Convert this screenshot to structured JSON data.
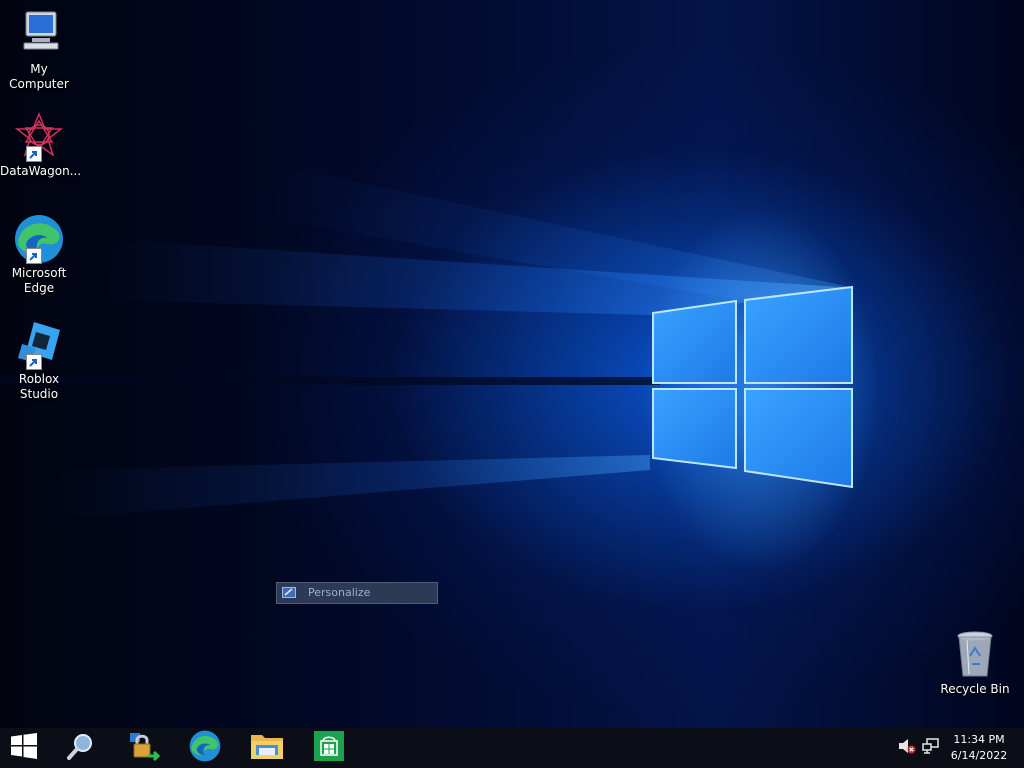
{
  "desktop": {
    "icons": [
      {
        "label": "My Computer",
        "icon": "computer-icon"
      },
      {
        "label": "DataWagon...",
        "icon": "datawagon-icon"
      },
      {
        "label": "Microsoft Edge",
        "icon": "edge-icon"
      },
      {
        "label": "Roblox Studio",
        "icon": "roblox-studio-icon"
      },
      {
        "label": "Recycle Bin",
        "icon": "recycle-bin-icon"
      }
    ],
    "context_menu": {
      "item": "Personalize",
      "icon": "personalize-icon"
    }
  },
  "taskbar": {
    "start": {
      "icon": "windows-start-icon"
    },
    "pinned": [
      {
        "icon": "search-icon"
      },
      {
        "icon": "security-lock-icon"
      },
      {
        "icon": "edge-icon"
      },
      {
        "icon": "file-explorer-icon"
      },
      {
        "icon": "store-icon"
      }
    ],
    "tray": {
      "volume_icon": "volume-muted-icon",
      "network_icon": "network-icon",
      "time": "11:34 PM",
      "date": "6/14/2022"
    }
  },
  "colors": {
    "taskbar": "#0b0e17",
    "wallpaper_accent": "#1a7cff",
    "store_green": "#1aa34a"
  }
}
